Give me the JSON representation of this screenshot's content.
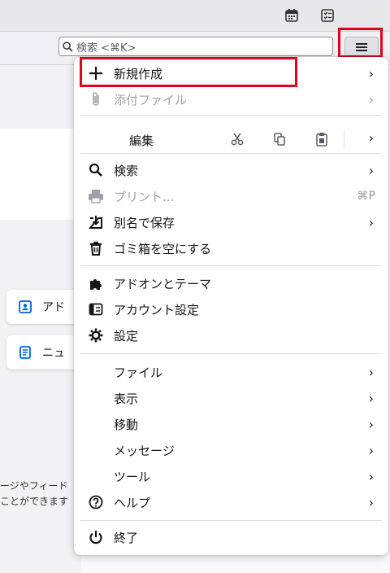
{
  "titlebar": {
    "icons": [
      "calendar-icon",
      "tasks-icon"
    ]
  },
  "toolbar": {
    "search_placeholder": "検索 <⌘K>",
    "menu_icon": "hamburger-icon"
  },
  "background": {
    "cards": [
      {
        "label": "アド",
        "icon": "address-book-icon"
      },
      {
        "label": "ニュ",
        "icon": "newsfeed-icon"
      }
    ],
    "text_lines": [
      "ージやフィード",
      "ことができます"
    ]
  },
  "menu": {
    "new": {
      "label": "新規作成"
    },
    "attach": {
      "label": "添付ファイル"
    },
    "edit": {
      "label": "編集",
      "icons": [
        "cut-icon",
        "copy-icon",
        "paste-icon"
      ]
    },
    "search": {
      "label": "検索"
    },
    "print": {
      "label": "プリント...",
      "shortcut": "⌘P"
    },
    "save_as": {
      "label": "別名で保存"
    },
    "empty_trash": {
      "label": "ゴミ箱を空にする"
    },
    "addons": {
      "label": "アドオンとテーマ"
    },
    "account_settings": {
      "label": "アカウント設定"
    },
    "settings": {
      "label": "設定"
    },
    "file": {
      "label": "ファイル"
    },
    "view": {
      "label": "表示"
    },
    "go": {
      "label": "移動"
    },
    "message": {
      "label": "メッセージ"
    },
    "tools": {
      "label": "ツール"
    },
    "help": {
      "label": "ヘルプ"
    },
    "quit": {
      "label": "終了"
    }
  },
  "chevron": "›",
  "colors": {
    "highlight": "#e0001a",
    "accent_blue": "#0060df"
  }
}
